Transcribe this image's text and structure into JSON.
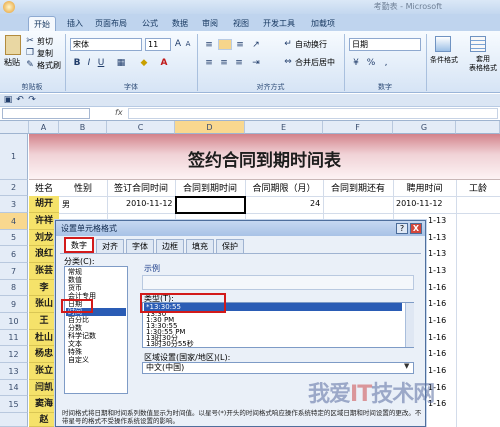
{
  "window": {
    "title": "考勤表 - Microsoft"
  },
  "ribbon_tabs": [
    "开始",
    "插入",
    "页面布局",
    "公式",
    "数据",
    "审阅",
    "视图",
    "开发工具",
    "加载项"
  ],
  "clipboard": {
    "paste": "粘贴",
    "cut": "剪切",
    "copy": "复制",
    "format_painter": "格式刷",
    "group": "剪贴板"
  },
  "font": {
    "name": "宋体",
    "size": "11",
    "group": "字体"
  },
  "alignment": {
    "wrap": "自动换行",
    "merge": "合并后居中",
    "group": "对齐方式"
  },
  "number": {
    "format": "日期",
    "group": "数字"
  },
  "styles": {
    "conditional": "条件格式",
    "table": "套用\n表格格式"
  },
  "formula_bar": {
    "fx": "fx"
  },
  "columns": [
    "A",
    "B",
    "C",
    "D",
    "E",
    "F",
    "G"
  ],
  "rows": [
    "1",
    "2",
    "3",
    "4",
    "5",
    "6",
    "7",
    "8",
    "9",
    "10",
    "11",
    "12",
    "13",
    "14",
    "15"
  ],
  "sheet": {
    "title": "签约合同到期时间表",
    "headers": [
      "姓名",
      "性别",
      "签订合同时间",
      "合同到期时间",
      "合同期限（月）",
      "合同到期还有",
      "聘用时间",
      "工龄"
    ],
    "names": [
      "胡开",
      "许祥",
      "刘龙",
      "浪红",
      "张芸",
      "李",
      "张山",
      "王",
      "杜山",
      "杨忠",
      "张立",
      "闫凯",
      "窦海",
      "赵"
    ],
    "row3": {
      "gender": "男",
      "sign_date": "2010-11-12",
      "term": "24",
      "hire_date": "2010-11-12"
    },
    "g_col_fragments": [
      "1-13",
      "1-13",
      "1-13",
      "1-13",
      "1-16",
      "1-16",
      "1-16",
      "1-16",
      "1-16",
      "1-16",
      "1-16",
      "1-16"
    ]
  },
  "dialog": {
    "title": "设置单元格格式",
    "tabs": [
      "数字",
      "对齐",
      "字体",
      "边框",
      "填充",
      "保护"
    ],
    "category_label": "分类(C):",
    "categories": [
      "常规",
      "数值",
      "货币",
      "会计专用",
      "日期",
      "时间",
      "百分比",
      "分数",
      "科学记数",
      "文本",
      "特殊",
      "自定义"
    ],
    "selected_category": "时间",
    "sample_label": "示例",
    "type_label": "类型(T):",
    "types": [
      "*13:30:55",
      "13:30",
      "1:30 PM",
      "13:30:55",
      "1:30:55 PM",
      "13时30分",
      "13时30分55秒"
    ],
    "selected_type": "*13:30:55",
    "locale_label": "区域设置(国家/地区)(L):",
    "locale": "中文(中国)",
    "description": "时间格式将日期和时间系列数值显示为时间值。以星号(*)开头的时间格式响应操作系统特定的区域日期和时间设置的更改。不带星号的格式不受操作系统设置的影响。",
    "help": "?",
    "close": "X"
  },
  "watermark": {
    "a": "我爱",
    "b": "IT",
    "c": "技术网"
  }
}
